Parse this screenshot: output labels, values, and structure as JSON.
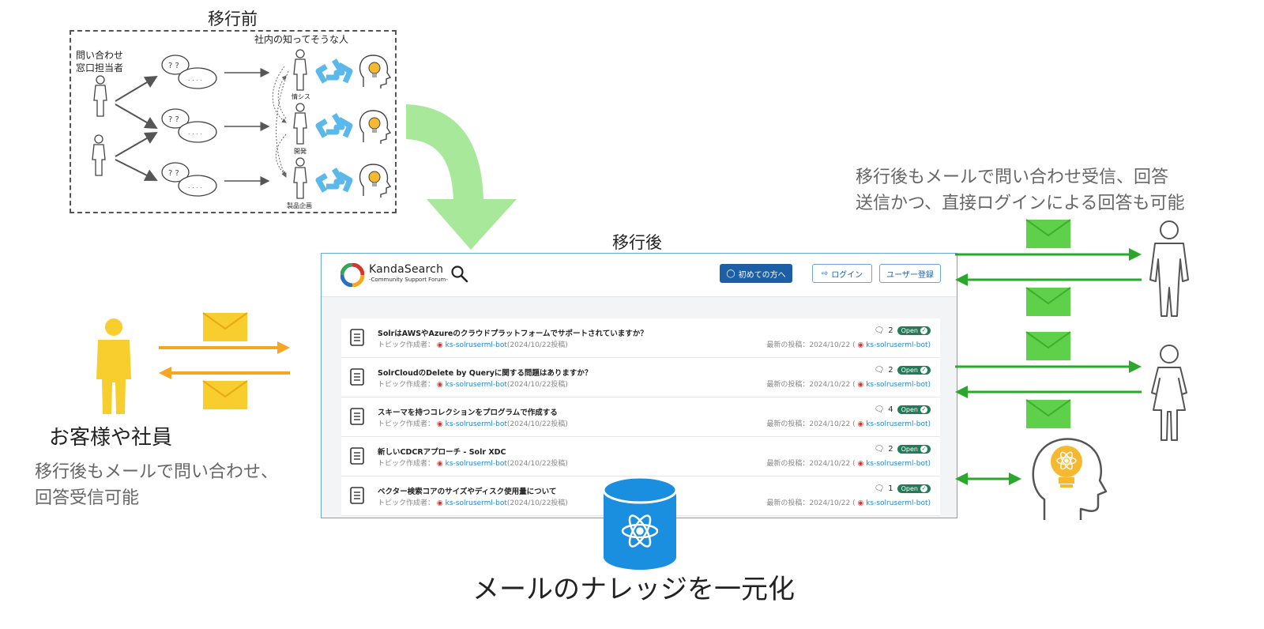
{
  "before": {
    "title": "移行前",
    "knowers_label": "社内の知ってそうな人",
    "contact_label_1": "問い合わせ",
    "contact_label_2": "窓口担当者",
    "roles": [
      "情シス",
      "開発",
      "製品企画"
    ]
  },
  "after": {
    "title": "移行後"
  },
  "app": {
    "brand": "KandaSearch",
    "brand_sub": "-Community Support Forum-",
    "buttons": {
      "first_time": "初めての方へ",
      "login": "ログイン",
      "register": "ユーザー登録"
    },
    "creator_prefix": "トピック作成者：",
    "latest_prefix": "最新の投稿：",
    "topics": [
      {
        "title": "SolrはAWSやAzureのクラウドプラットフォームでサポートされていますか？",
        "bot": "ks-solruserml-bot",
        "posted": "(2024/10/22投稿)",
        "count": "2",
        "status": "Open",
        "latest_date": "2024/10/22 (",
        "latest_bot": "ks-solruserml-bot)"
      },
      {
        "title": "SolrCloudのDelete by Queryに関する問題はありますか？",
        "bot": "ks-solruserml-bot",
        "posted": "(2024/10/22投稿)",
        "count": "2",
        "status": "Open",
        "latest_date": "2024/10/22 (",
        "latest_bot": "ks-solruserml-bot)"
      },
      {
        "title": "スキーマを持つコレクションをプログラムで作成する",
        "bot": "ks-solruserml-bot",
        "posted": "(2024/10/22投稿)",
        "count": "4",
        "status": "Open",
        "latest_date": "2024/10/22 (",
        "latest_bot": "ks-solruserml-bot)"
      },
      {
        "title": "新しいCDCRアプローチ - Solr XDC",
        "bot": "ks-solruserml-bot",
        "posted": "(2024/10/22投稿)",
        "count": "2",
        "status": "Open",
        "latest_date": "2024/10/22 (",
        "latest_bot": "ks-solruserml-bot)"
      },
      {
        "title": "ベクター検索コアのサイズやディスク使用量について",
        "bot": "ks-solruserml-bot",
        "posted": "(2024/10/22投稿)",
        "count": "1",
        "status": "Open",
        "latest_date": "2024/10/22 (",
        "latest_bot": "ks-solruserml-bot)"
      }
    ]
  },
  "right_note": {
    "line1": "移行後もメールで問い合わせ受信、回答",
    "line2": "送信かつ、直接ログインによる回答も可能"
  },
  "customer": {
    "label": "お客様や社員",
    "note_line1": "移行後もメールで問い合わせ、",
    "note_line2": "回答受信可能"
  },
  "bottom_label": "メールのナレッジを一元化",
  "colors": {
    "customer_yellow": "#f7ce2e",
    "arrow_orange": "#f5a623",
    "mail_green": "#5fd04a",
    "arrow_green": "#2aa82a",
    "big_arrow": "#a8e89a",
    "db_blue": "#1a8fe0",
    "recycle_blue": "#5ab9ea",
    "badge_green": "#247a57",
    "primary_button": "#1c5fa6"
  }
}
